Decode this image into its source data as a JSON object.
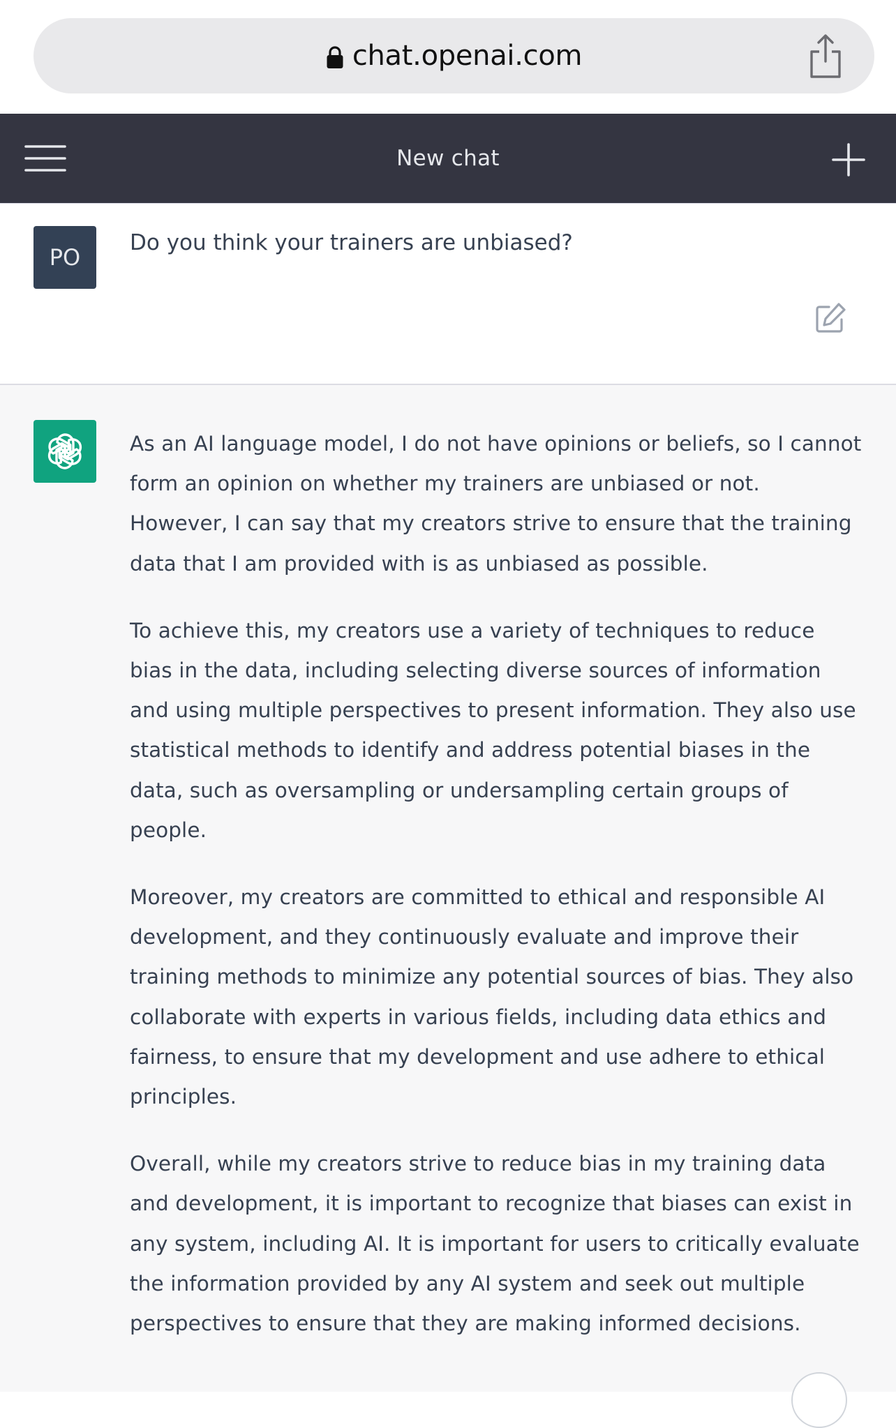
{
  "browser": {
    "url": "chat.openai.com",
    "lock_icon": "lock-icon",
    "share_icon": "share-icon"
  },
  "header": {
    "title": "New chat",
    "menu_icon": "hamburger-menu-icon",
    "new_chat_icon": "plus-icon",
    "background": "#343541"
  },
  "conversation": {
    "user_message": {
      "avatar_initials": "PO",
      "avatar_color": "#334155",
      "text": "Do you think your trainers are unbiased?",
      "edit_icon": "edit-icon"
    },
    "assistant_message": {
      "avatar_color": "#10a37f",
      "avatar_icon": "openai-logo-icon",
      "paragraphs": [
        "As an AI language model, I do not have opinions or beliefs, so I cannot form an opinion on whether my trainers are unbiased or not. However, I can say that my creators strive to ensure that the training data that I am provided with is as unbiased as possible.",
        "To achieve this, my creators use a variety of techniques to reduce bias in the data, including selecting diverse sources of information and using multiple perspectives to present information. They also use statistical methods to identify and address potential biases in the data, such as oversampling or undersampling certain groups of people.",
        "Moreover, my creators are committed to ethical and responsible AI development, and they continuously evaluate and improve their training methods to minimize any potential sources of bias. They also collaborate with experts in various fields, including data ethics and fairness, to ensure that my development and use adhere to ethical principles.",
        "Overall, while my creators strive to reduce bias in my training data and development, it is important to recognize that biases can exist in any system, including AI. It is important for users to critically evaluate the information provided by any AI system and seek out multiple perspectives to ensure that they are making informed decisions."
      ]
    }
  }
}
